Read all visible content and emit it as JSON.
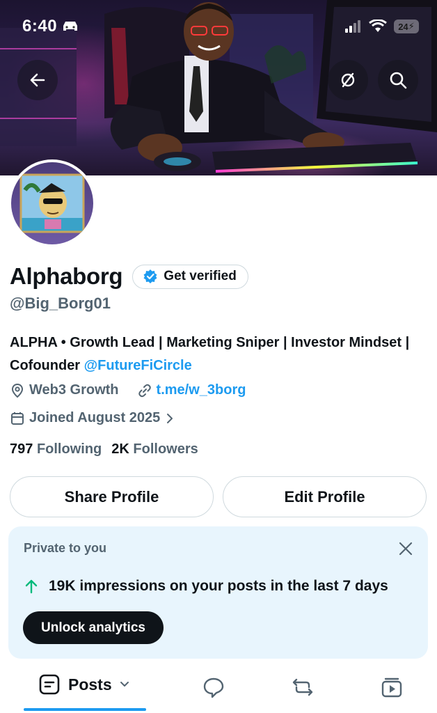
{
  "status_bar": {
    "time": "6:40",
    "battery": "24"
  },
  "banner": {
    "back_icon": "arrow-left-icon",
    "hide_icon": "eye-slash-icon",
    "search_icon": "search-icon"
  },
  "profile": {
    "display_name": "Alphaborg",
    "verify_label": "Get verified",
    "handle": "@Big_Borg01",
    "bio_text": "ALPHA • Growth Lead | Marketing Sniper | Investor Mindset | Cofounder ",
    "bio_mention": "@FutureFiCircle",
    "location": "Web3 Growth",
    "website": "t.me/w_3borg",
    "joined": "Joined August 2025",
    "following_count": "797",
    "following_label": "Following",
    "followers_count": "2K",
    "followers_label": "Followers"
  },
  "actions": {
    "share_label": "Share Profile",
    "edit_label": "Edit Profile"
  },
  "analytics": {
    "private_label": "Private to you",
    "impressions_text": "19K impressions on your posts in the last 7 days",
    "unlock_label": "Unlock analytics"
  },
  "tabs": {
    "posts_label": "Posts"
  },
  "colors": {
    "accent": "#1d9bf0",
    "text": "#0f1419",
    "muted": "#536471",
    "card_bg": "#e8f5fd",
    "trend_up": "#00ba7c"
  }
}
